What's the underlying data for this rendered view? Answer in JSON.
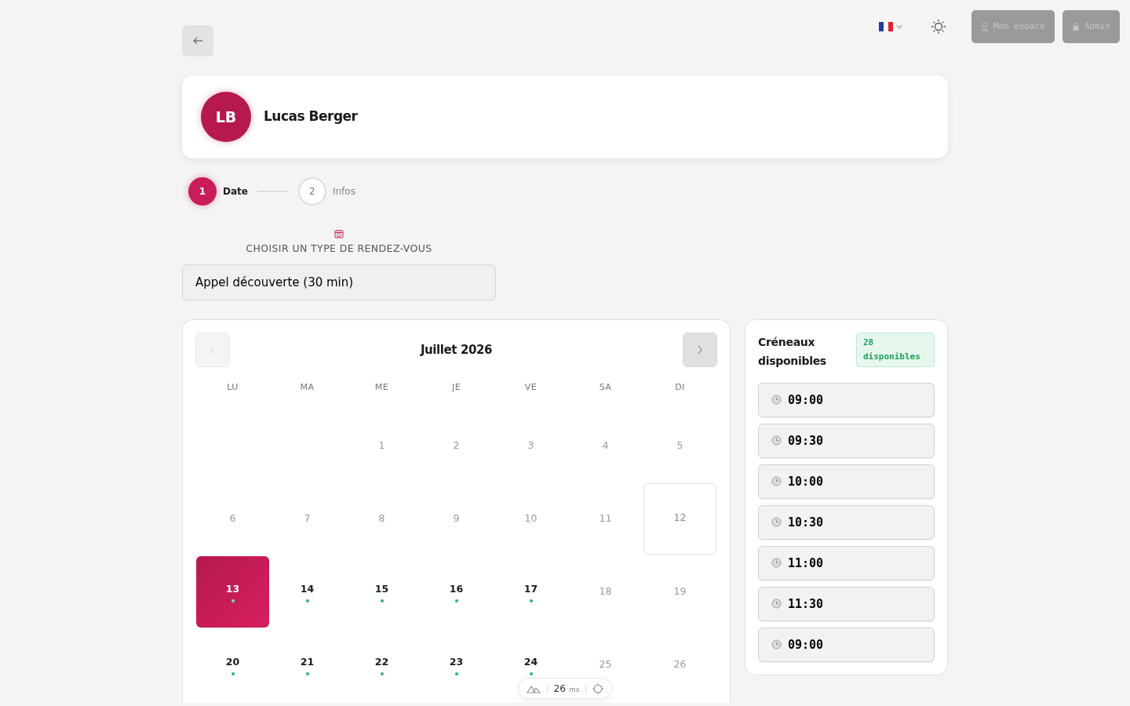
{
  "topbar": {
    "language": {
      "expanded": false
    },
    "buttons": [
      {
        "label": "Mon espace",
        "kind": "user",
        "disabled": true
      },
      {
        "label": "Admin",
        "kind": "lock",
        "disabled": true
      }
    ]
  },
  "profile": {
    "initials": "LB",
    "name": "Lucas Berger"
  },
  "steps": [
    {
      "number": "1",
      "label": "Date",
      "selected": true
    },
    {
      "number": "2",
      "label": "Infos",
      "selected": false
    }
  ],
  "type_select": {
    "label": "CHOISIR UN TYPE DE RENDEZ-VOUS",
    "value": "Appel découverte (30 min)"
  },
  "calendar": {
    "title": "Juillet 2026",
    "prev_disabled": true,
    "weekdays": [
      "LU",
      "MA",
      "ME",
      "JE",
      "VE",
      "SA",
      "DI"
    ],
    "days": [
      {
        "kind": "blank"
      },
      {
        "kind": "blank"
      },
      {
        "kind": "day",
        "label": "1",
        "available": false,
        "selected": false,
        "today": false
      },
      {
        "kind": "day",
        "label": "2",
        "available": false,
        "selected": false,
        "today": false
      },
      {
        "kind": "day",
        "label": "3",
        "available": false,
        "selected": false,
        "today": false
      },
      {
        "kind": "day",
        "label": "4",
        "available": false,
        "selected": false,
        "today": false
      },
      {
        "kind": "day",
        "label": "5",
        "available": false,
        "selected": false,
        "today": false
      },
      {
        "kind": "day",
        "label": "6",
        "available": false,
        "selected": false,
        "today": false
      },
      {
        "kind": "day",
        "label": "7",
        "available": false,
        "selected": false,
        "today": false
      },
      {
        "kind": "day",
        "label": "8",
        "available": false,
        "selected": false,
        "today": false
      },
      {
        "kind": "day",
        "label": "9",
        "available": false,
        "selected": false,
        "today": false
      },
      {
        "kind": "day",
        "label": "10",
        "available": false,
        "selected": false,
        "today": false
      },
      {
        "kind": "day",
        "label": "11",
        "available": false,
        "selected": false,
        "today": false
      },
      {
        "kind": "day",
        "label": "12",
        "available": false,
        "selected": false,
        "today": true
      },
      {
        "kind": "day",
        "label": "13",
        "available": true,
        "selected": true,
        "today": false
      },
      {
        "kind": "day",
        "label": "14",
        "available": true,
        "selected": false,
        "today": false
      },
      {
        "kind": "day",
        "label": "15",
        "available": true,
        "selected": false,
        "today": false
      },
      {
        "kind": "day",
        "label": "16",
        "available": true,
        "selected": false,
        "today": false
      },
      {
        "kind": "day",
        "label": "17",
        "available": true,
        "selected": false,
        "today": false
      },
      {
        "kind": "day",
        "label": "18",
        "available": false,
        "selected": false,
        "today": false
      },
      {
        "kind": "day",
        "label": "19",
        "available": false,
        "selected": false,
        "today": false
      },
      {
        "kind": "day",
        "label": "20",
        "available": true,
        "selected": false,
        "today": false
      },
      {
        "kind": "day",
        "label": "21",
        "available": true,
        "selected": false,
        "today": false
      },
      {
        "kind": "day",
        "label": "22",
        "available": true,
        "selected": false,
        "today": false
      },
      {
        "kind": "day",
        "label": "23",
        "available": true,
        "selected": false,
        "today": false
      },
      {
        "kind": "day",
        "label": "24",
        "available": true,
        "selected": false,
        "today": false
      },
      {
        "kind": "day",
        "label": "25",
        "available": false,
        "selected": false,
        "today": false
      },
      {
        "kind": "day",
        "label": "26",
        "available": false,
        "selected": false,
        "today": false
      }
    ]
  },
  "slots_panel": {
    "title": "Créneaux disponibles",
    "badge": "28 disponibles",
    "slots": [
      {
        "time": "09:00"
      },
      {
        "time": "09:30"
      },
      {
        "time": "10:00"
      },
      {
        "time": "10:30"
      },
      {
        "time": "11:00"
      },
      {
        "time": "11:30"
      },
      {
        "time": "09:00"
      }
    ]
  },
  "dev_pill": {
    "value": "26",
    "unit": "ms"
  }
}
